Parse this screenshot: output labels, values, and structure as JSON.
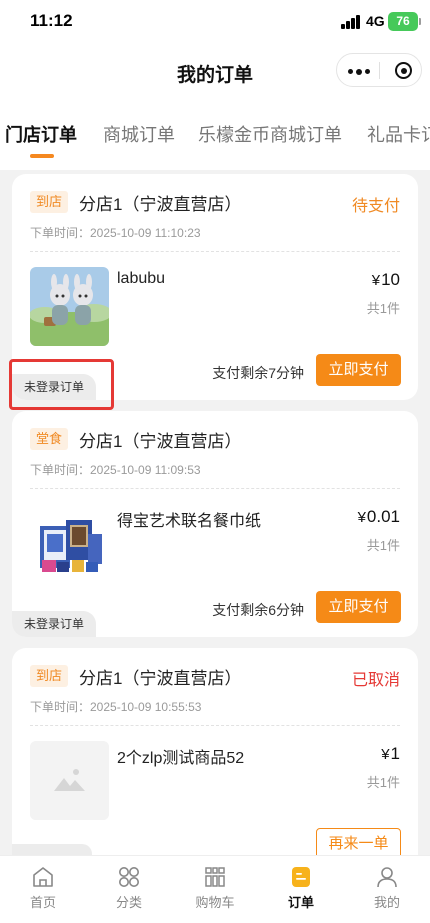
{
  "status_bar": {
    "time": "11:12",
    "network": "4G",
    "battery": "76"
  },
  "header": {
    "title": "我的订单"
  },
  "tabs": [
    {
      "label": "门店订单",
      "active": true
    },
    {
      "label": "商城订单",
      "active": false
    },
    {
      "label": "乐檬金币商城订单",
      "active": false
    },
    {
      "label": "礼品卡订",
      "active": false
    }
  ],
  "orders": [
    {
      "tag": "到店",
      "store": "分店1（宁波直营店）",
      "status": "待支付",
      "status_color": "#f08a24",
      "time": "下单时间：2025-10-09 11:10:23",
      "product": "labubu",
      "currency": "¥",
      "price": "10",
      "qty": "共1件",
      "remaining": "支付剩余7分钟",
      "button": "立即支付",
      "badge": "未登录订单"
    },
    {
      "tag": "堂食",
      "store": "分店1（宁波直营店）",
      "status": "",
      "time": "下单时间：2025-10-09 11:09:53",
      "product": "得宝艺术联名餐巾纸",
      "currency": "¥",
      "price": "0.01",
      "qty": "共1件",
      "remaining": "支付剩余6分钟",
      "button": "立即支付",
      "badge": "未登录订单"
    },
    {
      "tag": "到店",
      "store": "分店1（宁波直营店）",
      "status": "已取消",
      "status_color": "#e53935",
      "time": "下单时间：2025-10-09 10:55:53",
      "product": "2个zlp测试商品52",
      "currency": "¥",
      "price": "1",
      "qty": "共1件",
      "button": "再来一单"
    }
  ],
  "bottom_nav": [
    {
      "label": "首页",
      "icon": "home-icon"
    },
    {
      "label": "分类",
      "icon": "category-icon"
    },
    {
      "label": "购物车",
      "icon": "cart-icon"
    },
    {
      "label": "订单",
      "icon": "order-icon",
      "active": true
    },
    {
      "label": "我的",
      "icon": "profile-icon"
    }
  ],
  "colors": {
    "accent": "#f58a17",
    "pending": "#f08a24",
    "cancelled": "#e53935",
    "annotation": "#e53935"
  }
}
